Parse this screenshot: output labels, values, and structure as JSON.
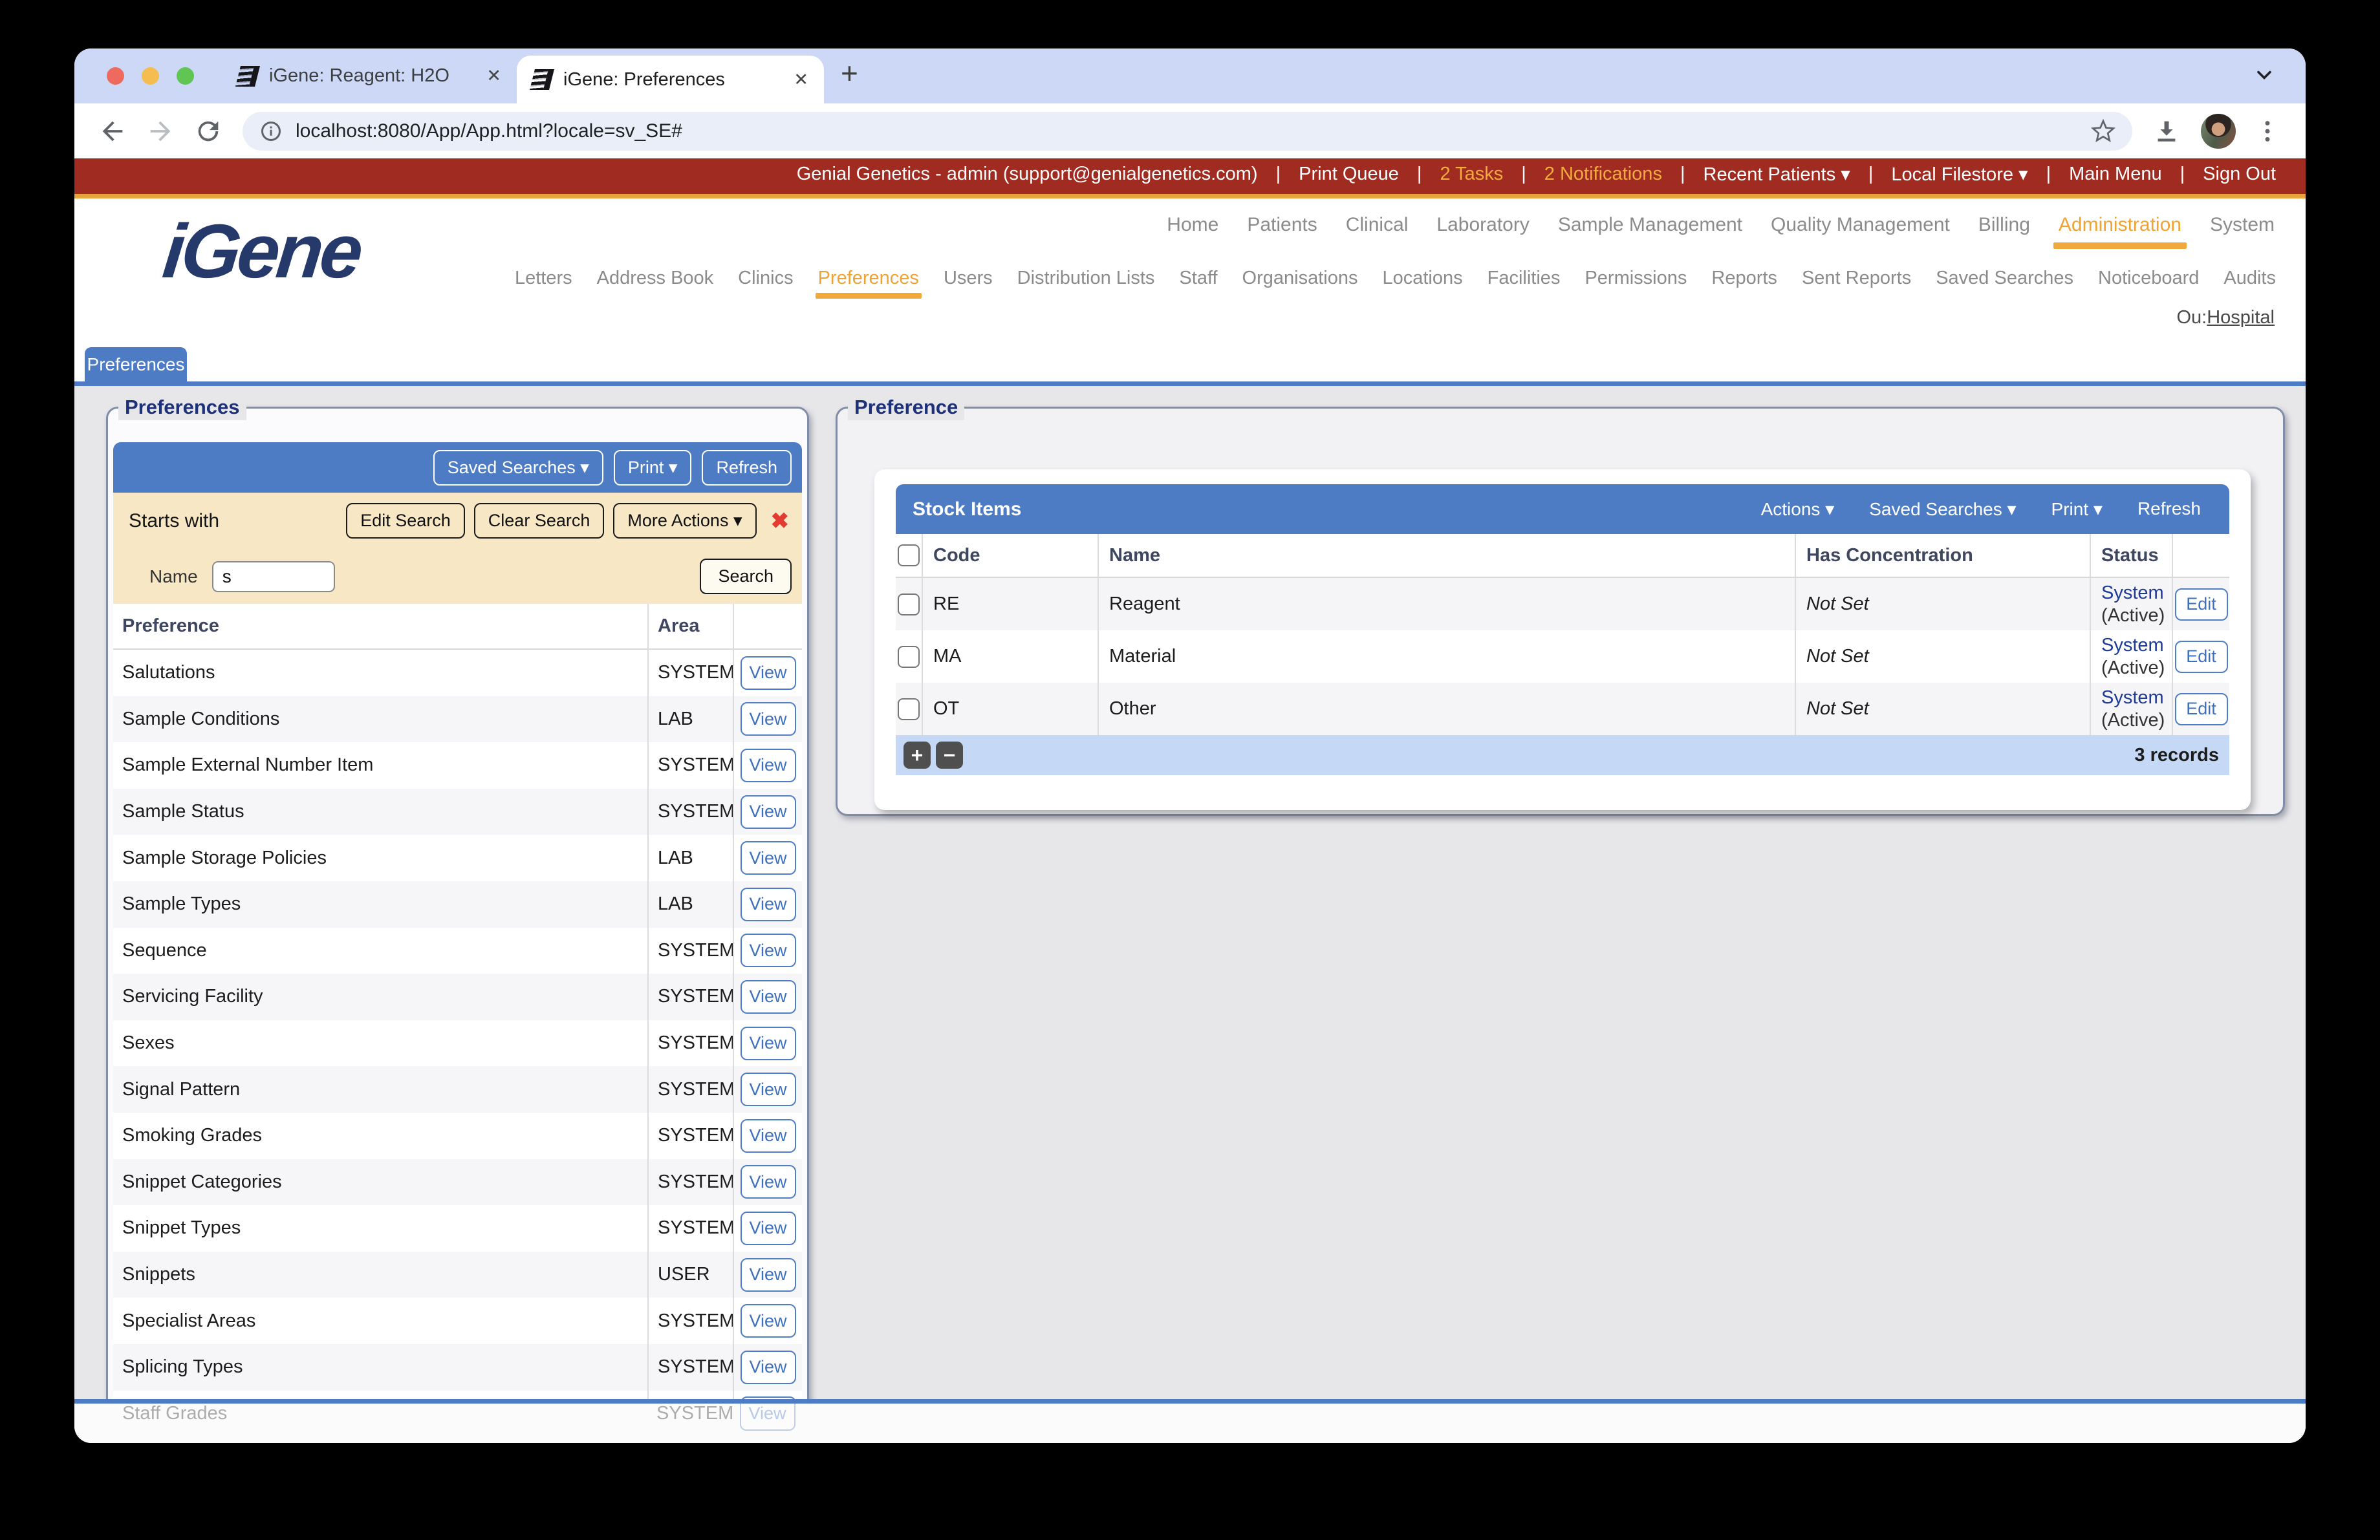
{
  "colors": {
    "accent_blue": "#4d7cc4",
    "accent_orange": "#f0a335",
    "topbar_red": "#a02b20",
    "navy": "#1e3077",
    "cream": "#f7e7c4"
  },
  "browser": {
    "tabs": [
      {
        "title": "iGene: Reagent: H2O"
      },
      {
        "title": "iGene: Preferences"
      }
    ],
    "close_glyph": "✕",
    "new_tab_glyph": "+",
    "url": "localhost:8080/App/App.html?locale=sv_SE#"
  },
  "topbar": {
    "user": "Genial Genetics - admin (support@genialgenetics.com)",
    "sep": "|",
    "print_queue": "Print Queue",
    "tasks": "2 Tasks",
    "notifications": "2 Notifications",
    "recent_patients": "Recent Patients ▾",
    "local_filestore": "Local Filestore ▾",
    "main_menu": "Main Menu",
    "sign_out": "Sign Out"
  },
  "brand": {
    "logo": "iGene"
  },
  "nav": {
    "primary": [
      "Home",
      "Patients",
      "Clinical",
      "Laboratory",
      "Sample Management",
      "Quality Management",
      "Billing",
      "Administration",
      "System"
    ],
    "secondary": [
      "Letters",
      "Address Book",
      "Clinics",
      "Preferences",
      "Users",
      "Distribution Lists",
      "Staff",
      "Organisations",
      "Locations",
      "Facilities",
      "Permissions",
      "Reports",
      "Sent Reports",
      "Saved Searches",
      "Noticeboard",
      "Audits"
    ],
    "ou_label": "Ou:",
    "ou_value": "Hospital"
  },
  "page_tab": "Preferences",
  "left_panel": {
    "legend": "Preferences",
    "toolbar": {
      "saved_searches": "Saved Searches ▾",
      "print": "Print ▾",
      "refresh": "Refresh"
    },
    "search": {
      "mode": "Starts with",
      "edit": "Edit Search",
      "clear": "Clear Search",
      "more": "More Actions ▾",
      "close": "✖",
      "name_label": "Name",
      "name_value": "s",
      "search": "Search"
    },
    "table": {
      "headers": {
        "name": "Preference",
        "area": "Area"
      },
      "view": "View",
      "rows": [
        {
          "name": "Salutations",
          "area": "SYSTEM"
        },
        {
          "name": "Sample Conditions",
          "area": "LAB"
        },
        {
          "name": "Sample External Number Item",
          "area": "SYSTEM"
        },
        {
          "name": "Sample Status",
          "area": "SYSTEM"
        },
        {
          "name": "Sample Storage Policies",
          "area": "LAB"
        },
        {
          "name": "Sample Types",
          "area": "LAB"
        },
        {
          "name": "Sequence",
          "area": "SYSTEM"
        },
        {
          "name": "Servicing Facility",
          "area": "SYSTEM"
        },
        {
          "name": "Sexes",
          "area": "SYSTEM"
        },
        {
          "name": "Signal Pattern",
          "area": "SYSTEM"
        },
        {
          "name": "Smoking Grades",
          "area": "SYSTEM"
        },
        {
          "name": "Snippet Categories",
          "area": "SYSTEM"
        },
        {
          "name": "Snippet Types",
          "area": "SYSTEM"
        },
        {
          "name": "Snippets",
          "area": "USER"
        },
        {
          "name": "Specialist Areas",
          "area": "SYSTEM"
        },
        {
          "name": "Splicing Types",
          "area": "SYSTEM"
        }
      ],
      "partial_row": {
        "name": "Staff Grades",
        "area": "SYSTEM"
      }
    }
  },
  "right_panel": {
    "legend": "Preference",
    "stock": {
      "title": "Stock Items",
      "actions": "Actions ▾",
      "saved_searches": "Saved Searches ▾",
      "print": "Print ▾",
      "refresh": "Refresh",
      "headers": {
        "code": "Code",
        "name": "Name",
        "has_concentration": "Has Concentration",
        "status": "Status"
      },
      "edit": "Edit",
      "add": "+",
      "remove": "−",
      "records": "3 records",
      "rows": [
        {
          "code": "RE",
          "name": "Reagent",
          "has_concentration": "Not Set",
          "status_main": "System",
          "status_sub": "(Active)"
        },
        {
          "code": "MA",
          "name": "Material",
          "has_concentration": "Not Set",
          "status_main": "System",
          "status_sub": "(Active)"
        },
        {
          "code": "OT",
          "name": "Other",
          "has_concentration": "Not Set",
          "status_main": "System",
          "status_sub": "(Active)"
        }
      ]
    }
  }
}
